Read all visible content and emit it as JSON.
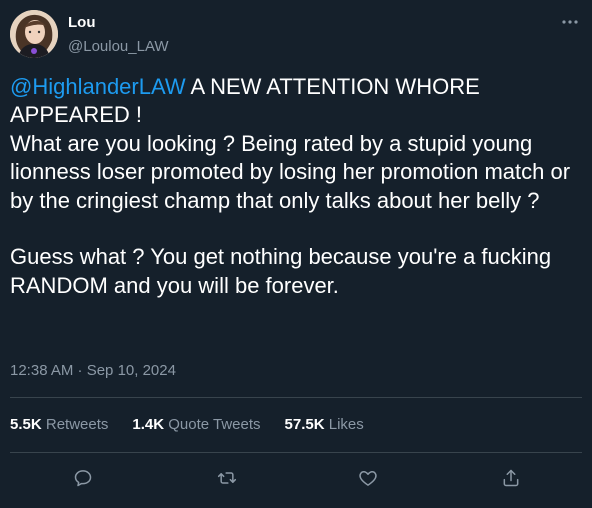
{
  "author": {
    "name": "Lou",
    "handle": "@Loulou_LAW",
    "avatar_icon": "profile-photo"
  },
  "tweet": {
    "mention": "@HighlanderLAW",
    "body": " A NEW ATTENTION WHORE APPEARED !\nWhat are you looking ? Being rated by a stupid young lionness loser promoted by losing her promotion match or by the cringiest champ that only talks about her belly ?\n\nGuess what ? You get nothing because you're a fucking RANDOM and you will be forever.",
    "timestamp": "12:38 AM · Sep 10, 2024"
  },
  "stats": {
    "retweets_count": "5.5K",
    "retweets_label": "Retweets",
    "quotes_count": "1.4K",
    "quotes_label": "Quote Tweets",
    "likes_count": "57.5K",
    "likes_label": "Likes"
  },
  "actions": {
    "icons": [
      "reply-icon",
      "retweet-icon",
      "like-icon",
      "share-icon"
    ]
  },
  "colors": {
    "background": "#15202b",
    "text": "#ffffff",
    "muted": "#8b98a5",
    "accent": "#1d9bf0",
    "divider": "#38444d"
  }
}
